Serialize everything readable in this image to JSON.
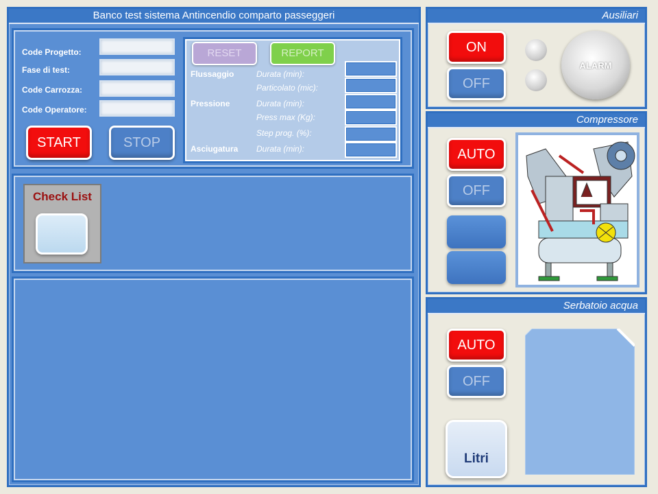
{
  "main_title": "Banco test sistema Antincendio comparto passeggeri",
  "form": {
    "code_progetto": "Code Progetto:",
    "fase_test": "Fase di test:",
    "code_carrozza": "Code Carrozza:",
    "code_operatore": "Code Operatore:",
    "start": "START",
    "stop": "STOP"
  },
  "params": {
    "reset": "RESET",
    "report": "REPORT",
    "flussaggio": "Flussaggio",
    "durata_min": "Durata (min):",
    "particolato": "Particolato (mic):",
    "pressione": "Pressione",
    "press_max": "Press max (Kg):",
    "step_prog": "Step prog. (%):",
    "asciugatura": "Asciugatura"
  },
  "checklist": {
    "title": "Check List"
  },
  "ausiliari": {
    "title": "Ausiliari",
    "on": "ON",
    "off": "OFF",
    "alarm": "ALARM"
  },
  "compressore": {
    "title": "Compressore",
    "auto": "AUTO",
    "off": "OFF"
  },
  "serbatoio": {
    "title": "Serbatoio acqua",
    "auto": "AUTO",
    "off": "OFF",
    "litri": "Litri"
  },
  "colors": {
    "accent": "#2f6fc0",
    "panel": "#5a8fd4",
    "red": "#f20d0d",
    "green": "#7fd04b"
  }
}
